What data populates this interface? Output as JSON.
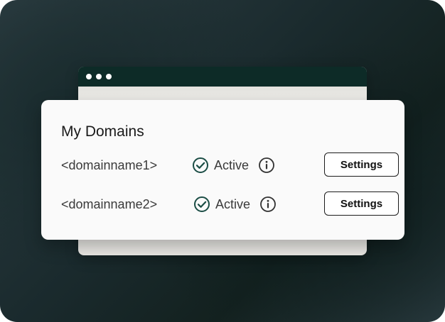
{
  "colors": {
    "browser_bar": "#0d2b27",
    "check_accent": "#1b4d45",
    "text": "#3a3a3a",
    "button_border": "#1c1c1c"
  },
  "card": {
    "title": "My Domains",
    "rows": [
      {
        "domain": "<domainname1>",
        "status": "Active",
        "status_icon": "check-circle-icon",
        "info_icon": "info-icon",
        "button_label": "Settings"
      },
      {
        "domain": "<domainname2>",
        "status": "Active",
        "status_icon": "check-circle-icon",
        "info_icon": "info-icon",
        "button_label": "Settings"
      }
    ]
  }
}
